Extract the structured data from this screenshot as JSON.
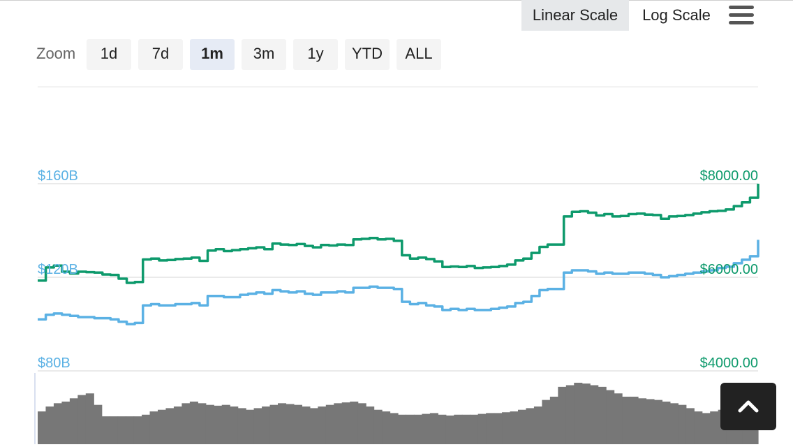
{
  "toolbar": {
    "scales": [
      {
        "label": "Linear Scale",
        "active": true
      },
      {
        "label": "Log Scale",
        "active": false
      }
    ],
    "menu_icon": "hamburger-icon"
  },
  "zoom": {
    "label": "Zoom",
    "buttons": [
      {
        "label": "1d",
        "active": false
      },
      {
        "label": "7d",
        "active": false
      },
      {
        "label": "1m",
        "active": true
      },
      {
        "label": "3m",
        "active": false
      },
      {
        "label": "1y",
        "active": false
      },
      {
        "label": "YTD",
        "active": false
      },
      {
        "label": "ALL",
        "active": false
      }
    ]
  },
  "colors": {
    "market_cap": "#5bb1e4",
    "price": "#0e9a6c",
    "volume": "#777777",
    "grid": "#e3e3e3"
  },
  "scroll_top_icon": "chevron-up-icon",
  "chart_data": {
    "type": "line",
    "x": [
      0,
      1,
      2,
      3,
      4,
      5,
      6,
      7,
      8,
      9,
      10,
      11,
      12,
      13,
      14,
      15,
      16,
      17,
      18,
      19,
      20,
      21,
      22,
      23,
      24,
      25,
      26,
      27,
      28,
      29,
      30,
      31,
      32,
      33,
      34,
      35,
      36,
      37,
      38,
      39,
      40,
      41,
      42,
      43,
      44,
      45,
      46,
      47,
      48,
      49,
      50,
      51,
      52,
      53,
      54,
      55,
      56,
      57,
      58,
      59,
      60,
      61,
      62,
      63,
      64,
      65,
      66,
      67,
      68,
      69,
      70,
      71,
      72,
      73,
      74,
      75,
      76,
      77,
      78,
      79,
      80,
      81,
      82,
      83,
      84,
      85,
      86,
      87,
      88,
      89
    ],
    "y_left_axis": {
      "ticks": [
        "$80B",
        "$120B",
        "$160B"
      ],
      "values": [
        80,
        120,
        160
      ],
      "range": [
        80,
        160
      ]
    },
    "y_right_axis": {
      "ticks": [
        "$4000.00",
        "$6000.00",
        "$8000.00"
      ],
      "values": [
        4000,
        6000,
        8000
      ],
      "range": [
        4000,
        8000
      ]
    },
    "series": [
      {
        "axis": "right",
        "values": [
          5930,
          6210,
          6250,
          6120,
          6080,
          6120,
          6110,
          6100,
          6060,
          6050,
          5970,
          5880,
          5900,
          6380,
          6400,
          6360,
          6370,
          6390,
          6400,
          6420,
          6350,
          6570,
          6600,
          6560,
          6580,
          6600,
          6620,
          6640,
          6600,
          6720,
          6700,
          6690,
          6710,
          6670,
          6640,
          6690,
          6680,
          6700,
          6690,
          6810,
          6820,
          6840,
          6810,
          6820,
          6780,
          6470,
          6400,
          6420,
          6390,
          6340,
          6220,
          6230,
          6220,
          6240,
          6200,
          6210,
          6220,
          6240,
          6270,
          6360,
          6400,
          6520,
          6650,
          6700,
          6700,
          7300,
          7400,
          7410,
          7380,
          7320,
          7350,
          7300,
          7310,
          7350,
          7360,
          7340,
          7330,
          7250,
          7300,
          7310,
          7330,
          7360,
          7390,
          7410,
          7420,
          7450,
          7520,
          7600,
          7700,
          8000
        ]
      },
      {
        "axis": "left",
        "values": [
          102,
          104,
          104.5,
          104,
          103.5,
          103,
          103,
          102.5,
          102.5,
          102,
          101,
          100,
          100.5,
          108,
          108.5,
          108,
          108,
          108.5,
          108.5,
          109,
          108,
          112,
          112,
          111.5,
          111.5,
          112.5,
          113,
          113.5,
          113,
          114.5,
          114,
          113.5,
          114,
          113,
          112.5,
          113.5,
          113.5,
          114,
          113.5,
          115.5,
          115.5,
          116,
          115.5,
          115.5,
          115,
          109.5,
          108.5,
          109,
          108,
          107.5,
          106,
          106.5,
          106,
          106.5,
          106,
          106,
          106.5,
          107,
          107.5,
          109,
          109.5,
          112,
          114.5,
          115,
          115,
          122,
          123,
          123,
          122.5,
          121.5,
          122,
          121.5,
          121.5,
          122,
          122,
          121.5,
          121,
          120,
          120.5,
          121,
          121.5,
          122,
          122.5,
          123,
          124,
          124.5,
          126,
          127.5,
          129,
          136
        ]
      }
    ],
    "volume": [
      40,
      46,
      50,
      52,
      56,
      60,
      62,
      48,
      34,
      34,
      34,
      34,
      34,
      36,
      40,
      42,
      44,
      46,
      50,
      52,
      50,
      48,
      47,
      48,
      46,
      44,
      42,
      44,
      46,
      48,
      50,
      49,
      48,
      46,
      44,
      46,
      48,
      50,
      51,
      52,
      50,
      46,
      42,
      40,
      38,
      36,
      36,
      36,
      37,
      38,
      36,
      35,
      36,
      36,
      36,
      37,
      38,
      38,
      39,
      40,
      42,
      44,
      46,
      54,
      58,
      70,
      72,
      75,
      74,
      72,
      70,
      66,
      62,
      58,
      58,
      56,
      55,
      54,
      52,
      50,
      48,
      44,
      40,
      38,
      40,
      42,
      46,
      50,
      56,
      70
    ]
  }
}
